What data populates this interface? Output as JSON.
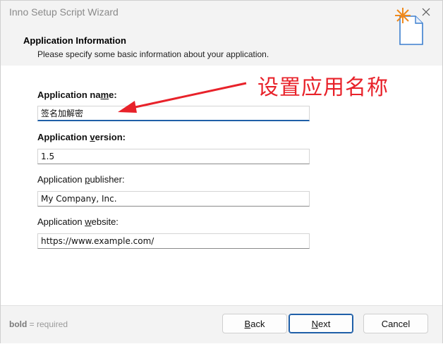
{
  "window": {
    "title": "Inno Setup Script Wizard"
  },
  "header": {
    "title": "Application Information",
    "subtitle": "Please specify some basic information about your application.",
    "icon": "wizard-page-icon"
  },
  "form": {
    "name": {
      "label_pre": "Application na",
      "label_key": "m",
      "label_post": "e:",
      "value": "签名加解密"
    },
    "version": {
      "label_pre": "Application ",
      "label_key": "v",
      "label_post": "ersion:",
      "value": "1.5"
    },
    "publisher": {
      "label_pre": "Application ",
      "label_key": "p",
      "label_post": "ublisher:",
      "value": "My Company, Inc."
    },
    "website": {
      "label_pre": "Application ",
      "label_key": "w",
      "label_post": "ebsite:",
      "value": "https://www.example.com/"
    }
  },
  "annotation": {
    "text": "设置应用名称",
    "color": "#e8222a"
  },
  "footer": {
    "note_bold": "bold",
    "note_rest": " = required",
    "back_key": "B",
    "back_rest": "ack",
    "next_key": "N",
    "next_rest": "ext",
    "cancel": "Cancel"
  },
  "colors": {
    "accent": "#1f5fa8",
    "header_bg": "#f3f3f3"
  }
}
